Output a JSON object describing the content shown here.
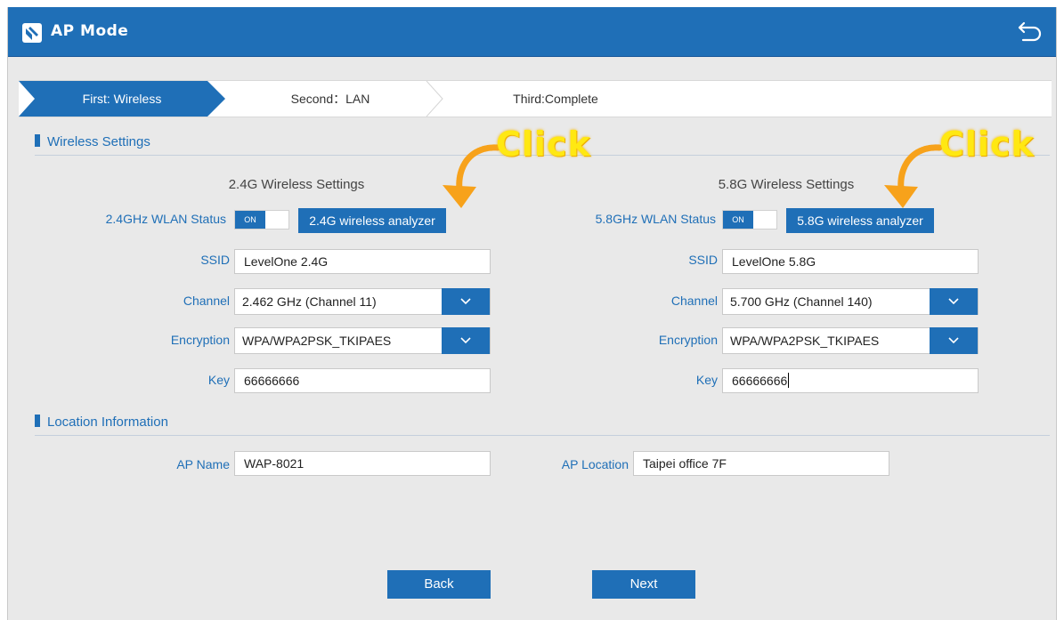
{
  "header": {
    "title": "AP Mode",
    "app_icon": "router-icon",
    "back_icon": "return-icon"
  },
  "steps": [
    "First: Wireless",
    "Second：LAN",
    "Third:Complete"
  ],
  "active_step": 0,
  "sections": {
    "wireless": "Wireless Settings",
    "location": "Location Information"
  },
  "band24": {
    "title": "2.4G Wireless Settings",
    "status_label": "2.4GHz WLAN Status",
    "toggle": "ON",
    "analyzer": "2.4G wireless analyzer",
    "ssid_label": "SSID",
    "ssid": "LevelOne 2.4G",
    "channel_label": "Channel",
    "channel": "2.462 GHz (Channel 11)",
    "encryption_label": "Encryption",
    "encryption": "WPA/WPA2PSK_TKIPAES",
    "key_label": "Key",
    "key": "66666666"
  },
  "band58": {
    "title": "5.8G Wireless Settings",
    "status_label": "5.8GHz WLAN Status",
    "toggle": "ON",
    "analyzer": "5.8G wireless analyzer",
    "ssid_label": "SSID",
    "ssid": "LevelOne 5.8G",
    "channel_label": "Channel",
    "channel": "5.700 GHz (Channel 140)",
    "encryption_label": "Encryption",
    "encryption": "WPA/WPA2PSK_TKIPAES",
    "key_label": "Key",
    "key": "66666666"
  },
  "location": {
    "ap_name_label": "AP Name",
    "ap_name": "WAP-8021",
    "ap_location_label": "AP Location",
    "ap_location": "Taipei office 7F"
  },
  "buttons": {
    "back": "Back",
    "next": "Next"
  },
  "annotations": {
    "click_left": "Click",
    "click_right": "Click"
  },
  "colors": {
    "primary": "#1f6fb7",
    "background": "#e9e9e9",
    "annotation": "#ffe812",
    "annotation_arrow": "#f7a21b"
  }
}
